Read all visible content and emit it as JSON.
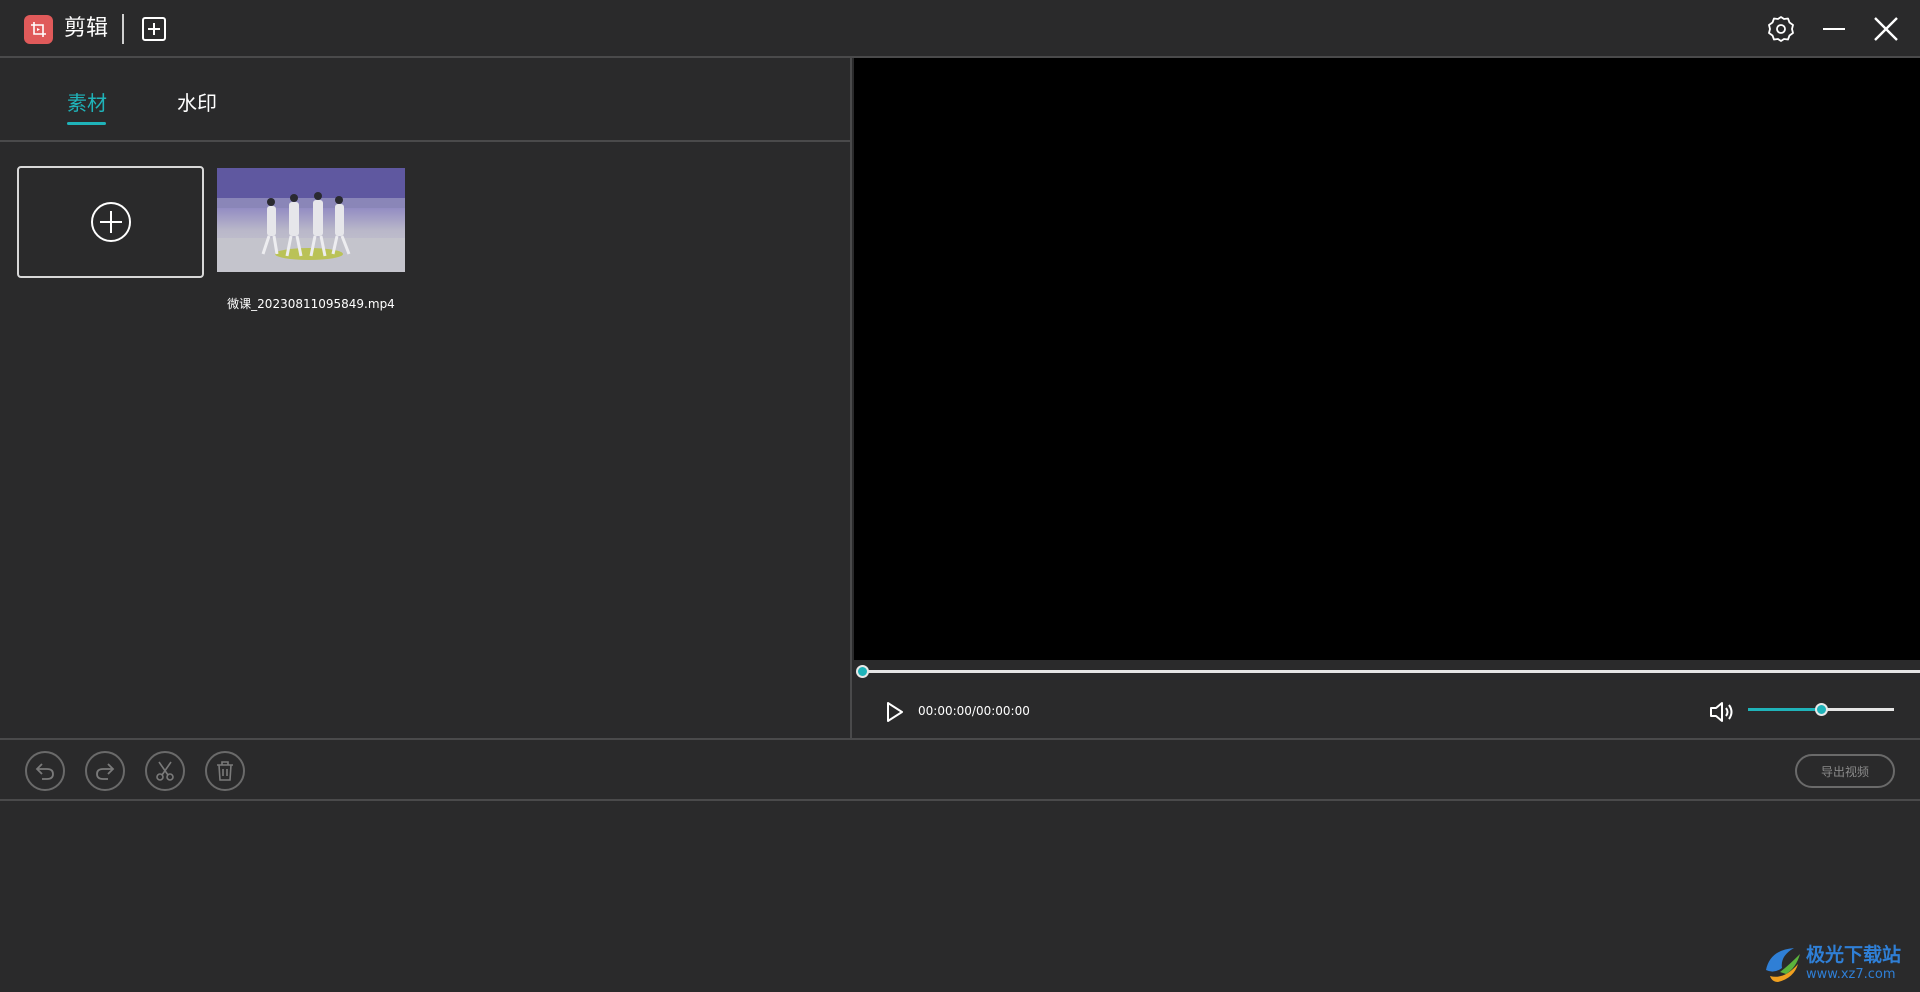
{
  "window": {
    "title": "剪辑",
    "new_icon": "plus-square-icon",
    "settings_icon": "gear-icon",
    "minimize_icon": "minimize-icon",
    "close_icon": "close-icon",
    "app_icon": "crop-icon",
    "accent_color": "#1fb3b9",
    "app_icon_color": "#e05a5a"
  },
  "tabs": [
    {
      "label": "素材",
      "active": true
    },
    {
      "label": "水印",
      "active": false
    }
  ],
  "media": {
    "add_icon": "circle-plus-icon",
    "items": [
      {
        "filename": "微课_20230811095849.mp4"
      }
    ]
  },
  "player": {
    "progress": 0,
    "time": "00:00:00/00:00:00",
    "volume": 0.5,
    "play_icon": "play-icon",
    "volume_icon": "speaker-icon"
  },
  "toolbar": {
    "undo_icon": "undo-icon",
    "redo_icon": "redo-icon",
    "cut_icon": "scissors-icon",
    "delete_icon": "trash-icon",
    "export_label": "导出视频"
  },
  "watermark": {
    "line1": "极光下载站",
    "line2": "www.xz7.com"
  }
}
